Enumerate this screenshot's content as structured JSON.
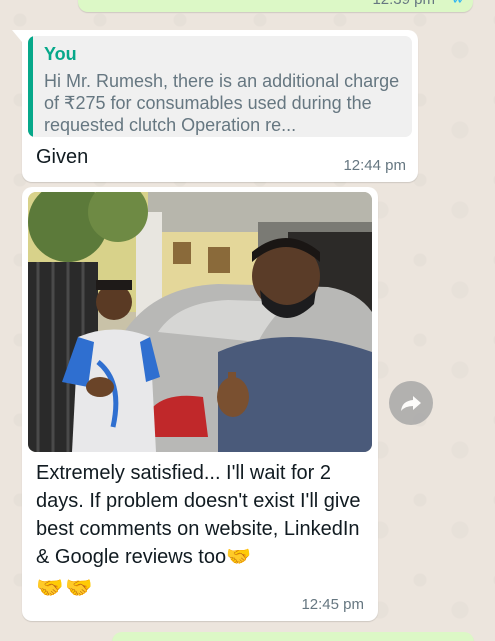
{
  "prev_message": {
    "time": "12:39 pm",
    "ticks": "✓✓"
  },
  "message1": {
    "quote_author": "You",
    "quote_text": "Hi Mr. Rumesh, there is an additional charge of ₹275 for consumables used during the requested clutch Operation re...",
    "text": "Given",
    "time": "12:44 pm"
  },
  "message2": {
    "text": "Extremely satisfied... I'll wait for 2 days. If problem doesn't exist I'll give best comments on website, LinkedIn & Google reviews too🤝",
    "emojis": "🤝🤝",
    "time": "12:45 pm"
  },
  "colors": {
    "chat_background": "#ece5dd",
    "outgoing_bubble": "#dcf8c6",
    "incoming_bubble": "#ffffff",
    "quote_accent": "#06a88a",
    "timestamp": "#667781"
  },
  "icons": {
    "forward": "forward-arrow-icon",
    "ticks": "double-check-icon"
  }
}
